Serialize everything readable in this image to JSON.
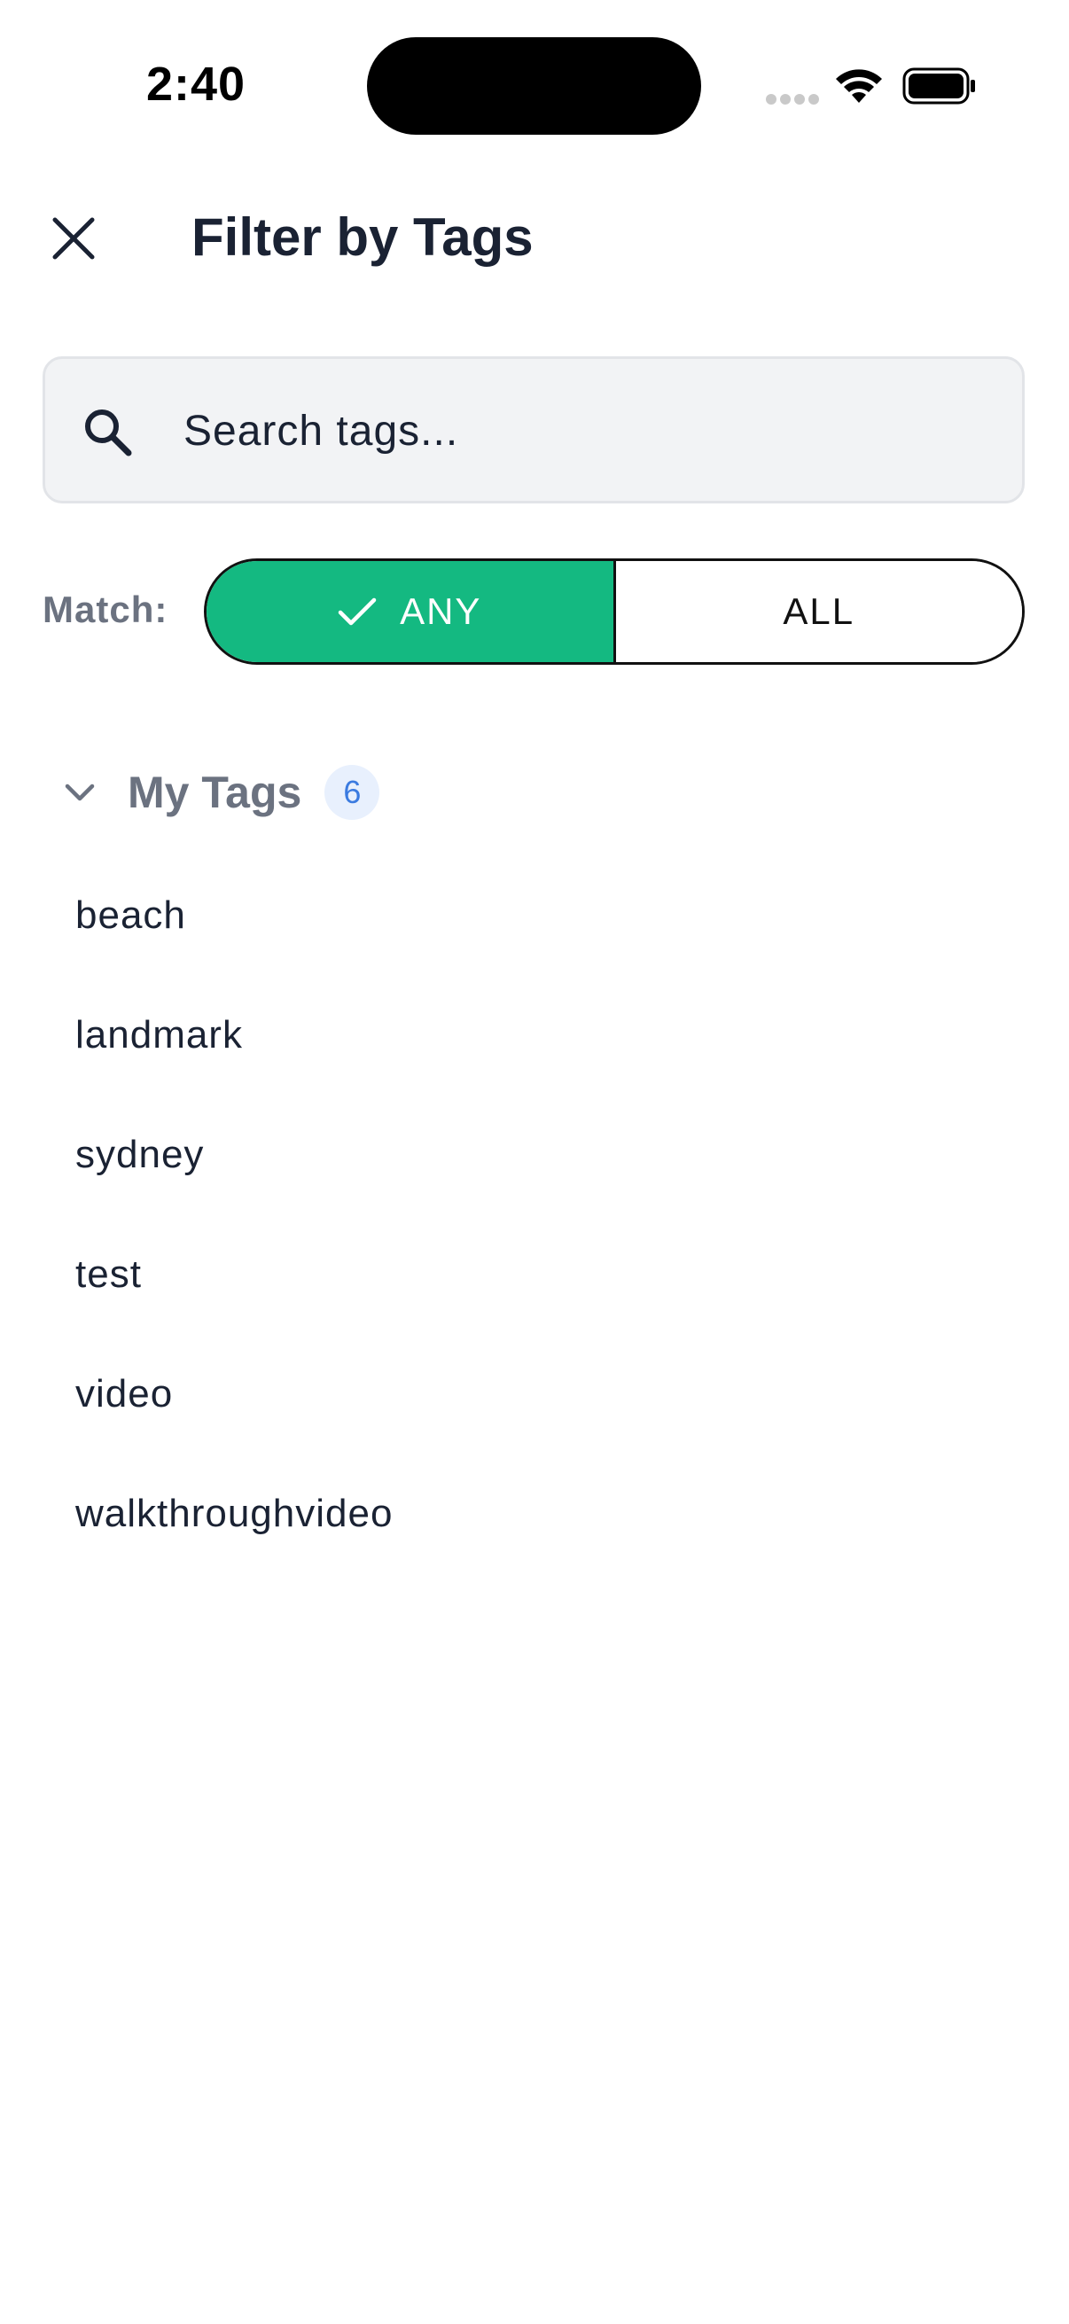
{
  "status_bar": {
    "time": "2:40"
  },
  "header": {
    "title": "Filter by Tags",
    "close_icon": "close-icon"
  },
  "search": {
    "placeholder": "Search tags...",
    "value": "",
    "icon": "search-icon"
  },
  "match": {
    "label": "Match:",
    "options": [
      "ANY",
      "ALL"
    ],
    "selected": "ANY"
  },
  "section": {
    "title": "My Tags",
    "count": "6",
    "expanded": true
  },
  "tags": [
    "beach",
    "landmark",
    "sydney",
    "test",
    "video",
    "walkthroughvideo"
  ],
  "colors": {
    "accent": "#14b981",
    "badge_bg": "#e8f0fd",
    "badge_text": "#3b7be0",
    "muted_text": "#6b7280",
    "primary_text": "#1a2233"
  }
}
